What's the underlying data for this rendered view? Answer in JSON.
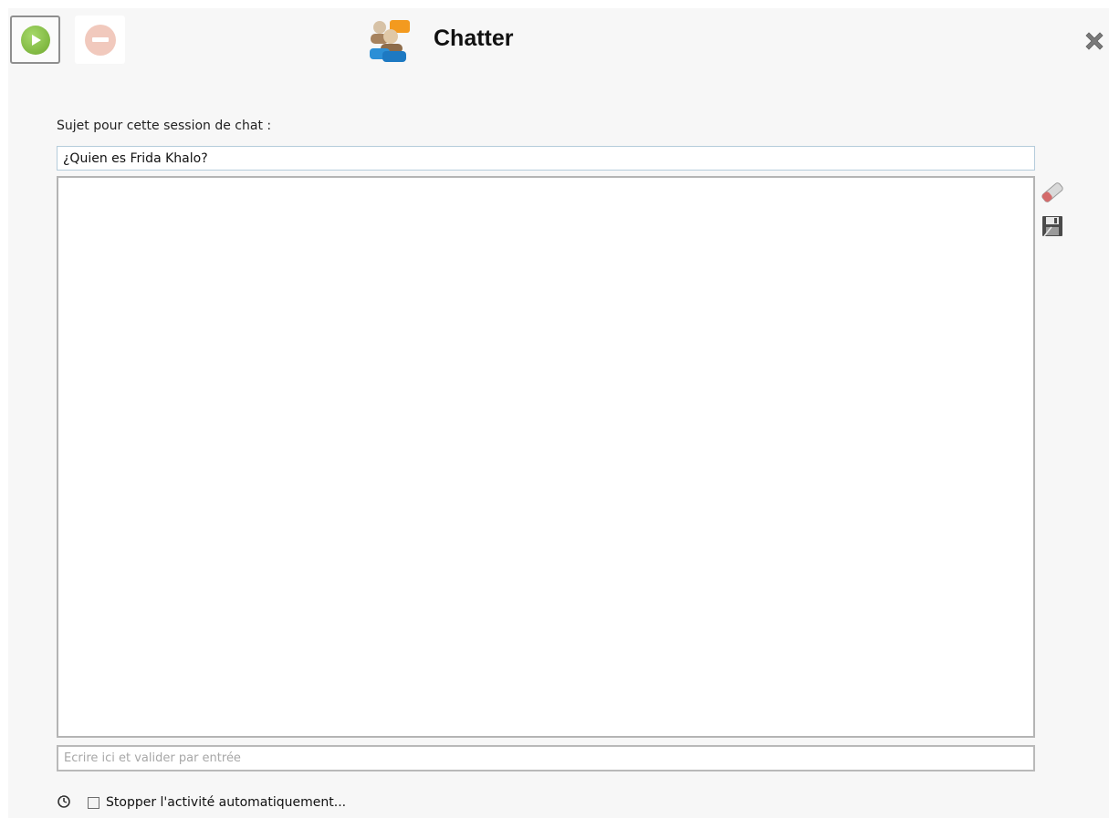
{
  "window": {
    "title": "Chatter"
  },
  "toolbar": {
    "start_icon": "play-icon",
    "stop_icon": "stop-icon",
    "close_icon": "close-icon",
    "app_icon": "chat-people-icon"
  },
  "subject": {
    "label": "Sujet pour cette session de chat :",
    "value": "¿Quien es Frida Khalo?"
  },
  "chat": {
    "messages": [],
    "tools": [
      "eraser-icon",
      "save-icon"
    ]
  },
  "input": {
    "value": "",
    "placeholder": "Ecrire ici et valider par entrée"
  },
  "auto_stop": {
    "label": "Stopper l'activité automatiquement...",
    "checked": false
  },
  "colors": {
    "play_green": "#6fa92f",
    "stop_pink": "#f1c9bd",
    "border": "#b4b4b4",
    "subject_border": "#b5ccdb"
  }
}
